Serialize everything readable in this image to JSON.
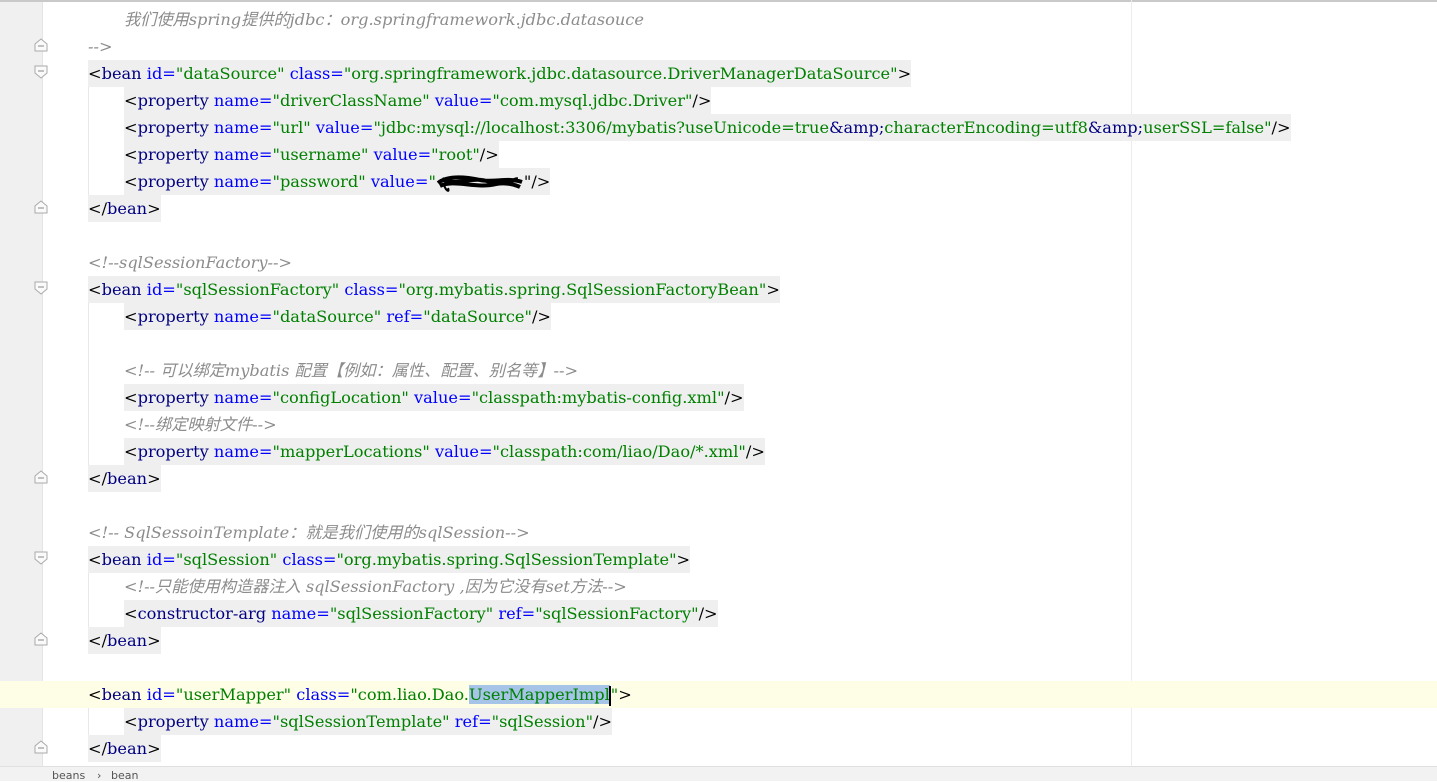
{
  "editor": {
    "lines": {
      "l1": {
        "text": "我们使用spring提供的jdbc：org.springframework.jdbc.datasouce"
      },
      "l2": {
        "text": "-->"
      },
      "l3": {
        "open": "<",
        "tag": "bean",
        "a1": "id=",
        "v1": "\"dataSource\"",
        "a2": "class=",
        "v2": "\"org.springframework.jdbc.datasource.DriverManagerDataSource\"",
        "close": ">"
      },
      "l4": {
        "open": "<",
        "tag": "property",
        "a1": "name=",
        "v1": "\"driverClassName\"",
        "a2": "value=",
        "v2": "\"com.mysql.jdbc.Driver\"",
        "close": "/>"
      },
      "l5": {
        "open": "<",
        "tag": "property",
        "a1": "name=",
        "v1": "\"url\"",
        "a2": "value=",
        "v2a": "\"jdbc:mysql://localhost:3306/mybatis?useUnicode=true",
        "amp1": "&amp;",
        "v2b": "characterEncoding=utf8",
        "amp2": "&amp;",
        "v2c": "userSSL=false\"",
        "close": "/>"
      },
      "l6": {
        "open": "<",
        "tag": "property",
        "a1": "name=",
        "v1": "\"username\"",
        "a2": "value=",
        "v2": "\"root\"",
        "close": "/>"
      },
      "l7": {
        "open": "<",
        "tag": "property",
        "a1": "name=",
        "v1": "\"password\"",
        "a2": "value=",
        "v2": "\"",
        "close": "\"/>"
      },
      "l8": {
        "open": "</",
        "tag": "bean",
        "close": ">"
      },
      "l10": {
        "text": "<!--sqlSessionFactory-->"
      },
      "l11": {
        "open": "<",
        "tag": "bean",
        "a1": "id=",
        "v1": "\"sqlSessionFactory\"",
        "a2": "class=",
        "v2": "\"org.mybatis.spring.SqlSessionFactoryBean\"",
        "close": ">"
      },
      "l12": {
        "open": "<",
        "tag": "property",
        "a1": "name=",
        "v1": "\"dataSource\"",
        "a2": "ref=",
        "v2": "\"dataSource\"",
        "close": "/>"
      },
      "l14": {
        "text": "<!-- 可以绑定mybatis 配置【例如：属性、配置、别名等】-->"
      },
      "l15": {
        "open": "<",
        "tag": "property",
        "a1": "name=",
        "v1": "\"configLocation\"",
        "a2": "value=",
        "v2": "\"classpath:mybatis-config.xml\"",
        "close": "/>"
      },
      "l16": {
        "text": "<!--绑定映射文件-->"
      },
      "l17": {
        "open": "<",
        "tag": "property",
        "a1": "name=",
        "v1": "\"mapperLocations\"",
        "a2": "value=",
        "v2": "\"classpath:com/liao/Dao/*.xml\"",
        "close": "/>"
      },
      "l18": {
        "open": "</",
        "tag": "bean",
        "close": ">"
      },
      "l20": {
        "text": "<!-- SqlSessoinTemplate：就是我们使用的sqlSession-->"
      },
      "l21": {
        "open": "<",
        "tag": "bean",
        "a1": "id=",
        "v1": "\"sqlSession\"",
        "a2": "class=",
        "v2": "\"org.mybatis.spring.SqlSessionTemplate\"",
        "close": ">"
      },
      "l22": {
        "text": "<!--只能使用构造器注入 sqlSessionFactory ,因为它没有set方法-->"
      },
      "l23": {
        "open": "<",
        "tag": "constructor-arg",
        "a1": "name=",
        "v1": "\"sqlSessionFactory\"",
        "a2": "ref=",
        "v2": "\"sqlSessionFactory\"",
        "close": "/>"
      },
      "l24": {
        "open": "</",
        "tag": "bean",
        "close": ">"
      },
      "l26": {
        "open": "<",
        "tag": "bean",
        "a1": "id=",
        "v1": "\"userMapper\"",
        "a2": "class=",
        "v2a": "\"com.liao.Dao.",
        "v2sel": "UserMapperImpl",
        "v2b": "\"",
        "close": ">"
      },
      "l27": {
        "open": "<",
        "tag": "property",
        "a1": "name=",
        "v1": "\"sqlSessionTemplate\"",
        "a2": "ref=",
        "v2": "\"sqlSession\"",
        "close": "/>"
      },
      "l28": {
        "open": "</",
        "tag": "bean",
        "close": ">"
      }
    }
  },
  "breadcrumb": {
    "items": [
      "beans",
      "bean"
    ],
    "separator": "›"
  },
  "colors": {
    "tag": "#000080",
    "attr": "#0000ff",
    "value": "#008000",
    "comment": "#8c8c8c",
    "selection": "#a5c4e7",
    "current_line": "#fefde5"
  }
}
